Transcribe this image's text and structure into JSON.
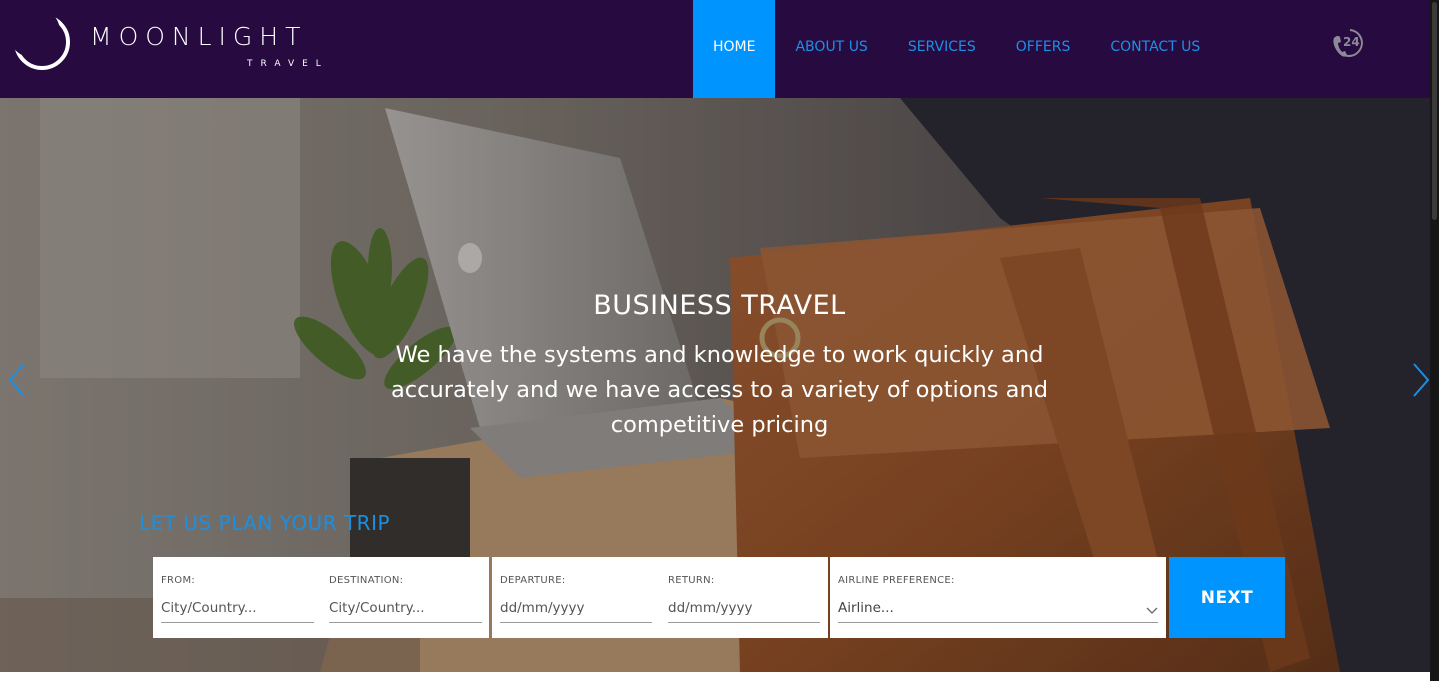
{
  "brand": {
    "name": "MOONLIGHT",
    "tagline": "TRAVEL"
  },
  "nav": {
    "items": [
      {
        "label": "HOME",
        "active": true
      },
      {
        "label": "ABOUT US",
        "active": false
      },
      {
        "label": "SERVICES",
        "active": false
      },
      {
        "label": "OFFERS",
        "active": false
      },
      {
        "label": "CONTACT US",
        "active": false
      }
    ],
    "support_icon": "phone-24-hours-icon"
  },
  "hero": {
    "title": "BUSINESS TRAVEL",
    "description": "We have the systems and knowledge to work quickly and accurately and we have access to a variety of options and competitive pricing",
    "prev_icon": "chevron-left-icon",
    "next_icon": "chevron-right-icon"
  },
  "booking": {
    "heading": "LET US PLAN YOUR TRIP",
    "from": {
      "label": "FROM:",
      "placeholder": "City/Country..."
    },
    "destination": {
      "label": "DESTINATION:",
      "placeholder": "City/Country..."
    },
    "departure": {
      "label": "DEPARTURE:",
      "placeholder": "dd/mm/yyyy"
    },
    "return": {
      "label": "RETURN:",
      "placeholder": "dd/mm/yyyy"
    },
    "airline": {
      "label": "AIRLINE PREFERENCE:",
      "selected": "Airline..."
    },
    "next_label": "NEXT"
  },
  "colors": {
    "header_bg": "#260a40",
    "accent": "#0094ff",
    "nav_text": "#1e8fe6",
    "plan_heading": "#1a8fe3"
  }
}
